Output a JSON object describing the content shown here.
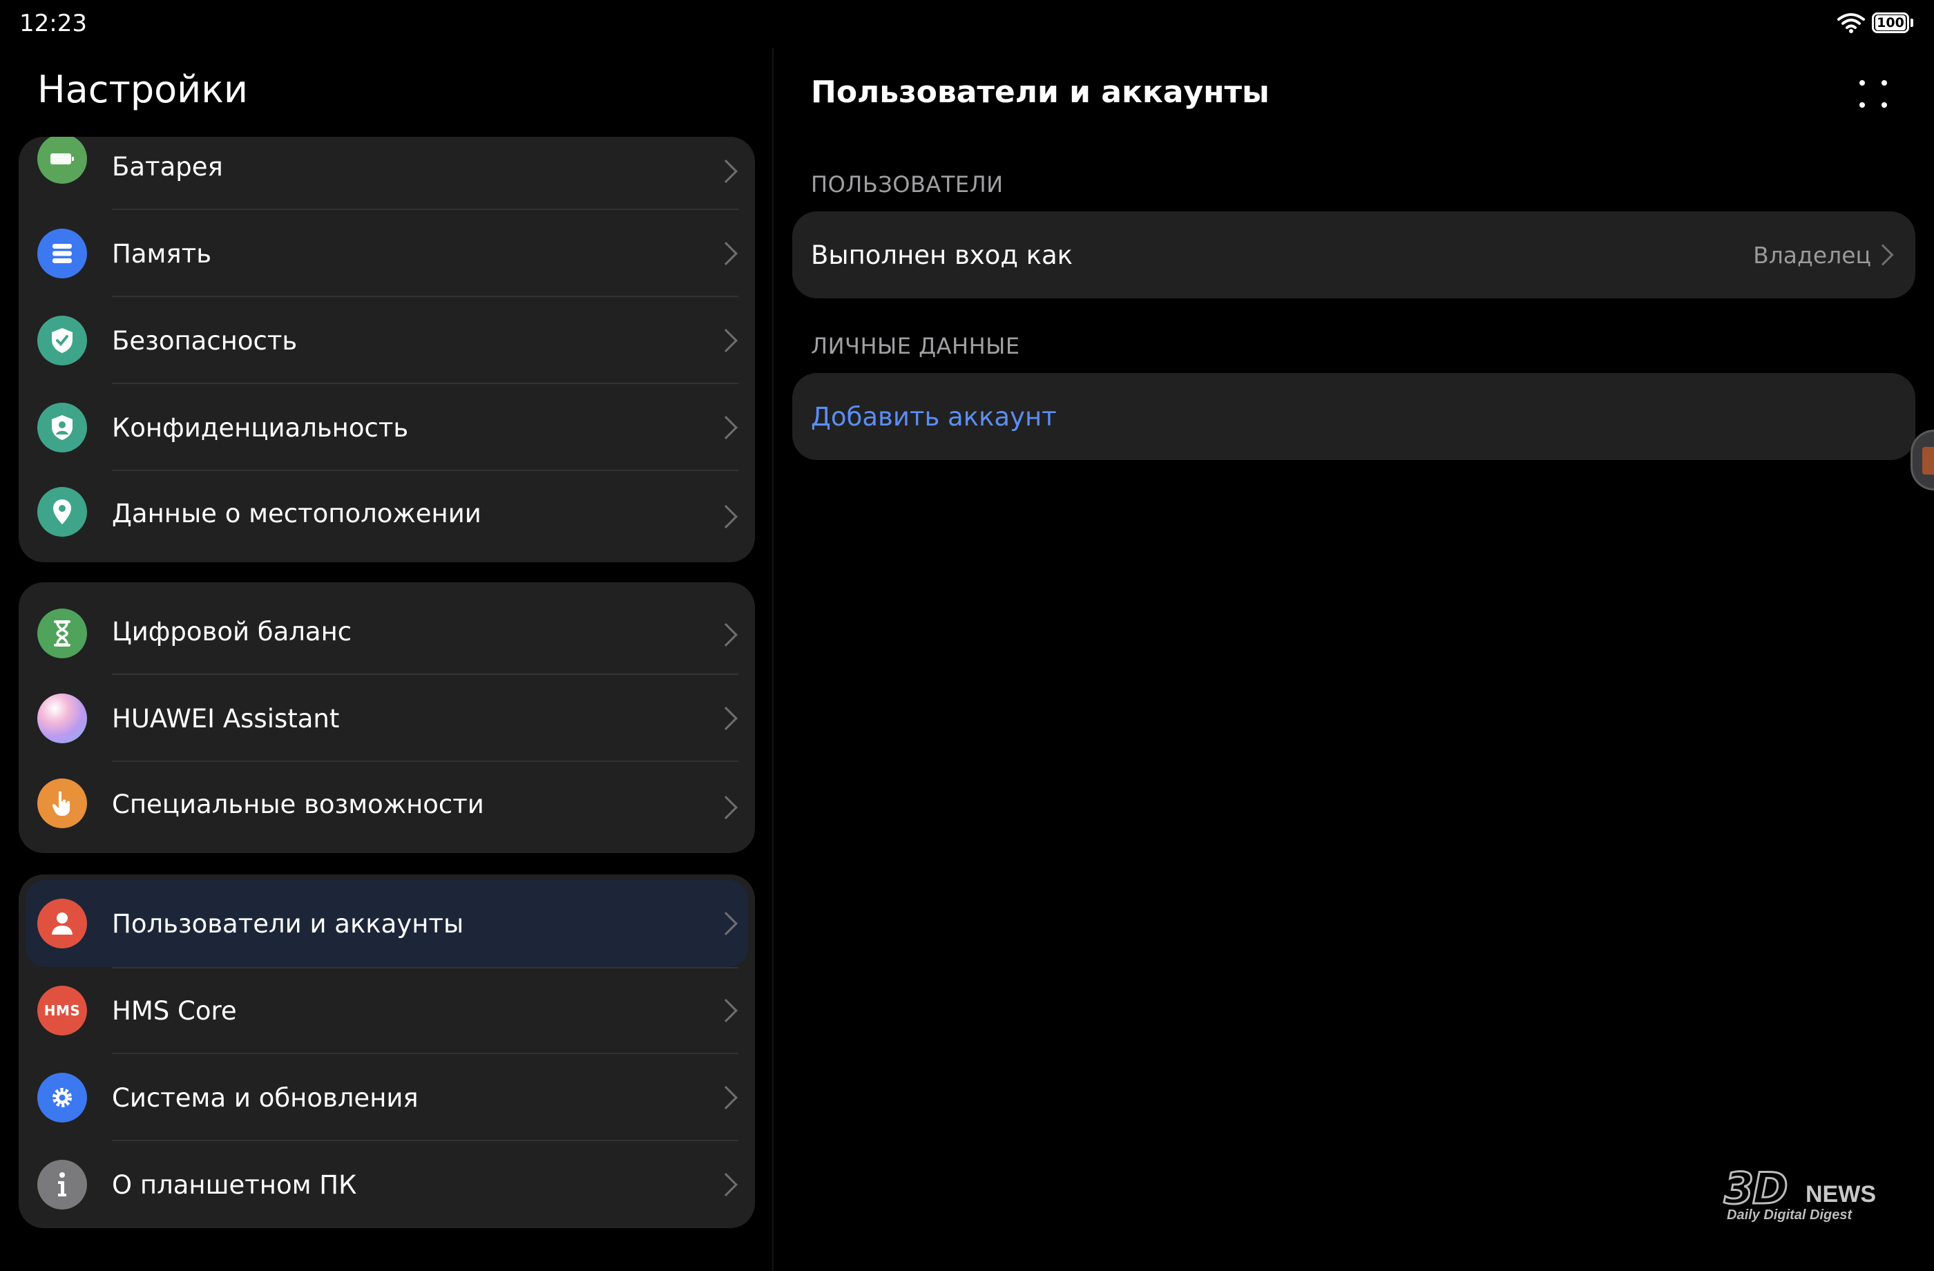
{
  "status_bar": {
    "time": "12:23",
    "battery": "100"
  },
  "settings": {
    "title": "Настройки",
    "groups": [
      {
        "items": [
          {
            "label": "Батарея",
            "icon": "battery-icon",
            "color": "#5aa55a"
          },
          {
            "label": "Память",
            "icon": "storage-icon",
            "color": "#3c78f0"
          },
          {
            "label": "Безопасность",
            "icon": "security-shield-icon",
            "color": "#3fa58a"
          },
          {
            "label": "Конфиденциальность",
            "icon": "privacy-shield-icon",
            "color": "#3fa58a"
          },
          {
            "label": "Данные о местоположении",
            "icon": "location-pin-icon",
            "color": "#3fa58a"
          }
        ]
      },
      {
        "items": [
          {
            "label": "Цифровой баланс",
            "icon": "hourglass-icon",
            "color": "#4fa35a"
          },
          {
            "label": "HUAWEI Assistant",
            "icon": "assistant-icon",
            "color": "#e0a0e8"
          },
          {
            "label": "Специальные возможности",
            "icon": "accessibility-hand-icon",
            "color": "#e8913a"
          }
        ]
      },
      {
        "items": [
          {
            "label": "Пользователи и аккаунты",
            "icon": "user-icon",
            "color": "#e0523f",
            "selected": true
          },
          {
            "label": "HMS Core",
            "icon": "hms-icon",
            "color": "#e0523f",
            "icon_text": "HMS"
          },
          {
            "label": "Система и обновления",
            "icon": "gear-icon",
            "color": "#3c78f0"
          },
          {
            "label": "О планшетном ПК",
            "icon": "info-icon",
            "color": "#7a7a7c"
          }
        ]
      }
    ]
  },
  "detail": {
    "title": "Пользователи и аккаунты",
    "sections": [
      {
        "header": "ПОЛЬЗОВАТЕЛИ",
        "row_label": "Выполнен вход как",
        "row_value": "Владелец"
      },
      {
        "header": "ЛИЧНЫЕ ДАННЫЕ",
        "link_label": "Добавить аккаунт"
      }
    ]
  },
  "watermark": {
    "logo": "3D",
    "news": "NEWS",
    "tagline": "Daily Digital Digest"
  }
}
